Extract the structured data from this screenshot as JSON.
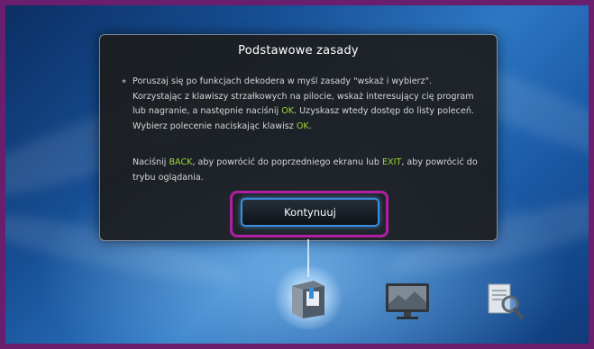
{
  "dialog": {
    "title": "Podstawowe zasady",
    "bullet": "*",
    "para1": {
      "t1": "Poruszaj się po funkcjach dekodera w myśl zasady \"wskaż i wybierz\". Korzystając z klawiszy strzałkowych na pilocie, wskaż interesujący cię program lub nagranie, a następnie naciśnij ",
      "k1": "OK",
      "t2": ". Uzyskasz wtedy dostęp do listy poleceń. Wybierz polecenie naciskając klawisz ",
      "k2": "OK",
      "t3": "."
    },
    "para2": {
      "t1": "Naciśnij ",
      "k1": "BACK",
      "t2": ", aby powrócić do poprzedniego ekranu lub ",
      "k2": "EXIT",
      "t3": ", aby powrócić do trybu oglądania."
    },
    "button_label": "Kontynuuj"
  },
  "menu_icons": [
    {
      "icon": "guide-book-icon",
      "state": "selected"
    },
    {
      "icon": "tv-icon",
      "state": "normal"
    },
    {
      "icon": "search-document-icon",
      "state": "normal"
    }
  ],
  "colors": {
    "highlight_key": "#9fd23a",
    "focus_border": "#b01fa3",
    "button_border": "#3a8ee0"
  }
}
